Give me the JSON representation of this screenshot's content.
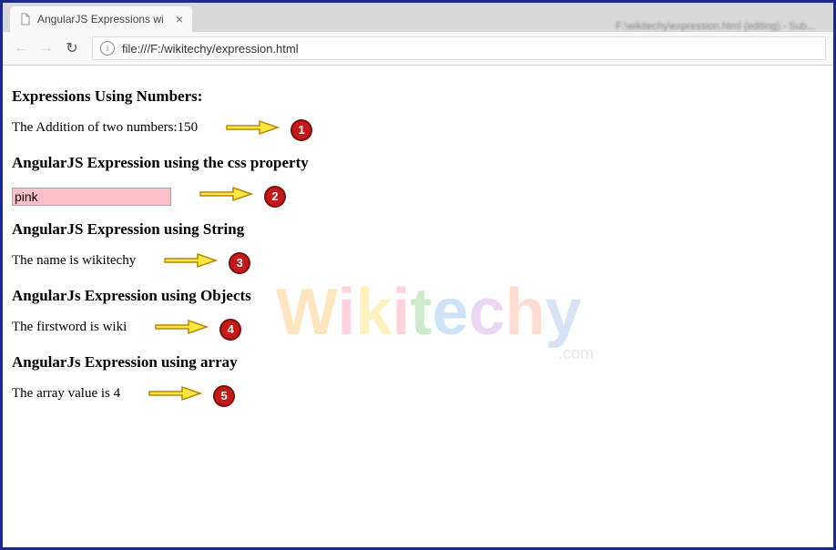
{
  "browser": {
    "tab_title": "AngularJS Expressions wi",
    "url": "file:///F:/wikitechy/expression.html",
    "info_glyph": "i",
    "blurred_topright": "F:\\wikitechy\\expression.html (editing) - Sub...",
    "close_glyph": "×",
    "back_glyph": "←",
    "forward_glyph": "→",
    "reload_glyph": "↻"
  },
  "headings": {
    "h1": "Expressions Using Numbers:",
    "h2": "AngularJS Expression using the css property",
    "h3": "AngularJS Expression using String",
    "h4": "AngularJs Expression using Objects",
    "h5": "AngularJs Expression using array"
  },
  "lines": {
    "line1": "The Addition of two numbers:150",
    "line2_input_value": "pink",
    "line3": "The name is wikitechy",
    "line4": "The firstword is wiki",
    "line5": "The array value is 4"
  },
  "badges": {
    "b1": "1",
    "b2": "2",
    "b3": "3",
    "b4": "4",
    "b5": "5"
  },
  "colors": {
    "pink_input_bg": "#ffc0cb",
    "badge_bg": "#c51a1a",
    "badge_border": "#7a0f0f",
    "arrow_fill": "#ffe640",
    "arrow_stroke": "#b8860b",
    "frame_border": "#1a2a8a"
  },
  "watermark": {
    "text": "Wikitechy",
    "suffix": ".com"
  }
}
